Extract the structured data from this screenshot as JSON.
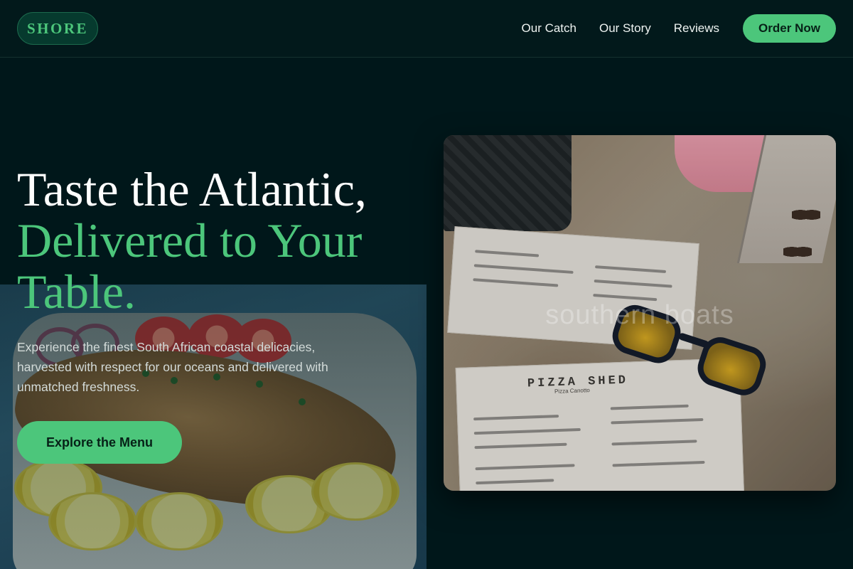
{
  "header": {
    "logo": "SHORE",
    "nav": [
      {
        "label": "Our Catch"
      },
      {
        "label": "Our Story"
      },
      {
        "label": "Reviews"
      }
    ],
    "order_label": "Order Now"
  },
  "hero": {
    "title_line1": "Taste the Atlantic,",
    "title_line2": "Delivered to Your Table.",
    "subtitle": "Experience the finest South African coastal delicacies, harvested with respect for our oceans and delivered with unmatched freshness.",
    "cta_label": "Explore the Menu"
  },
  "photo": {
    "watermark": "southern boats",
    "menu_title": "PIZZA SHED",
    "menu_subtitle": "Pizza Canotto"
  },
  "colors": {
    "background": "#00171a",
    "accent": "#4cc67b",
    "text": "#ffffff"
  }
}
